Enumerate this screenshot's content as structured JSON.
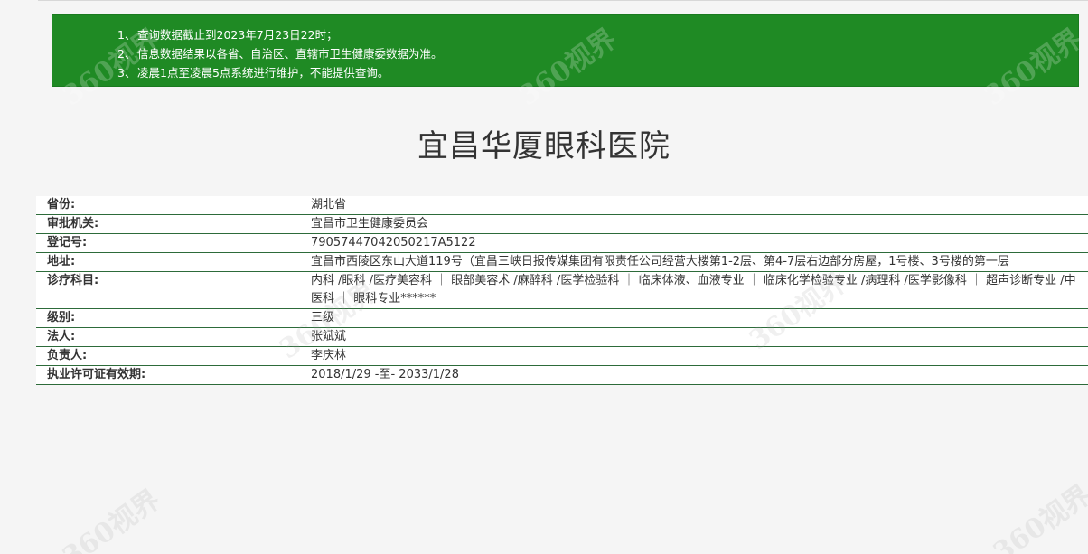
{
  "notice": {
    "items": [
      {
        "num": "1、",
        "text": "查询数据截止到2023年7月23日22时；"
      },
      {
        "num": "2、",
        "text": "信息数据结果以各省、自治区、直辖市卫生健康委数据为准。"
      },
      {
        "num": "3、",
        "text": "凌晨1点至凌晨5点系统进行维护，不能提供查询。"
      }
    ],
    "background": "#1f8a24"
  },
  "page_title": "宜昌华厦眼科医院",
  "rows": [
    {
      "label": "省份:",
      "value": "湖北省"
    },
    {
      "label": "审批机关:",
      "value": "宜昌市卫生健康委员会"
    },
    {
      "label": "登记号:",
      "value": "79057447042050217A5122"
    },
    {
      "label": "地址:",
      "value": "宜昌市西陵区东山大道119号（宜昌三峡日报传媒集团有限责任公司经营大楼第1-2层、第4-7层右边部分房屋，1号楼、3号楼的第一层"
    },
    {
      "label": "诊疗科目:",
      "value": "内科 /眼科 /医疗美容科 ｜ 眼部美容术 /麻醉科 /医学检验科 ｜ 临床体液、血液专业 ｜ 临床化学检验专业 /病理科 /医学影像科 ｜ 超声诊断专业 /中医科 ｜ 眼科专业******"
    },
    {
      "label": "级别:",
      "value": "三级"
    },
    {
      "label": "法人:",
      "value": "张斌斌"
    },
    {
      "label": "负责人:",
      "value": "李庆林"
    },
    {
      "label": "执业许可证有效期:",
      "value": "2018/1/29 -至- 2033/1/28"
    }
  ],
  "watermark_text": "360视界"
}
